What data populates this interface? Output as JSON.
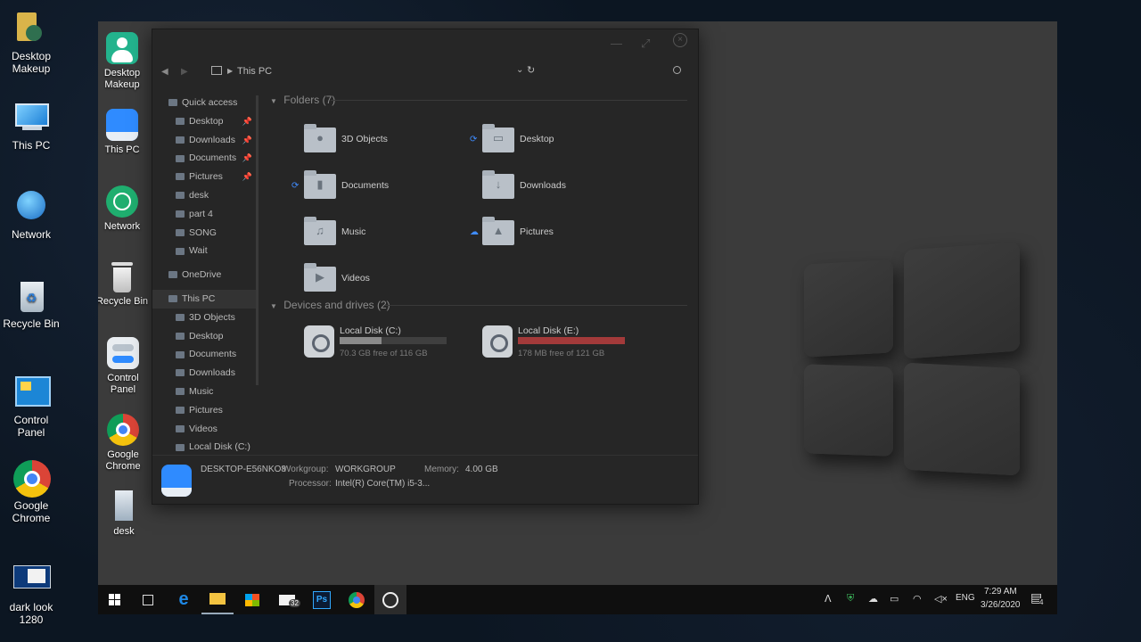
{
  "outer_desktop": [
    {
      "label": "Desktop Makeup",
      "icon": "folder-user-icon"
    },
    {
      "label": "This PC",
      "icon": "computer-icon"
    },
    {
      "label": "Network",
      "icon": "network-globe-icon"
    },
    {
      "label": "Recycle Bin",
      "icon": "recycle-bin-icon"
    },
    {
      "label": "Control Panel",
      "icon": "control-panel-icon"
    },
    {
      "label": "Google Chrome",
      "icon": "chrome-icon"
    },
    {
      "label": "dark look 1280",
      "icon": "shortcut-icon"
    }
  ],
  "inner_desktop": [
    {
      "label": "Desktop Makeup",
      "icon": "user-icon"
    },
    {
      "label": "This PC",
      "icon": "computer-icon"
    },
    {
      "label": "Network",
      "icon": "network-icon"
    },
    {
      "label": "Recycle Bin",
      "icon": "recycle-bin-icon"
    },
    {
      "label": "Control Panel",
      "icon": "toggle-icon"
    },
    {
      "label": "Google Chrome",
      "icon": "chrome-icon"
    },
    {
      "label": "desk",
      "icon": "document-icon"
    }
  ],
  "explorer": {
    "address": "This PC",
    "nav": {
      "quick_access": "Quick access",
      "quick_items": [
        {
          "label": "Desktop",
          "pinned": true
        },
        {
          "label": "Downloads",
          "pinned": true
        },
        {
          "label": "Documents",
          "pinned": true
        },
        {
          "label": "Pictures",
          "pinned": true
        },
        {
          "label": "desk",
          "pinned": false
        },
        {
          "label": "part 4",
          "pinned": false
        },
        {
          "label": "SONG",
          "pinned": false
        },
        {
          "label": "Wait",
          "pinned": false
        }
      ],
      "onedrive": "OneDrive",
      "this_pc": "This PC",
      "pc_items": [
        "3D Objects",
        "Desktop",
        "Documents",
        "Downloads",
        "Music",
        "Pictures",
        "Videos",
        "Local Disk (C:)"
      ]
    },
    "folders_header": "Folders (7)",
    "folders": [
      {
        "name": "3D Objects",
        "glyph": "●",
        "sync": ""
      },
      {
        "name": "Desktop",
        "glyph": "▭",
        "sync": "⟳"
      },
      {
        "name": "Documents",
        "glyph": "▮",
        "sync": "⟳"
      },
      {
        "name": "Downloads",
        "glyph": "↓",
        "sync": ""
      },
      {
        "name": "Music",
        "glyph": "♫",
        "sync": ""
      },
      {
        "name": "Pictures",
        "glyph": "▲",
        "sync": "☁"
      },
      {
        "name": "Videos",
        "glyph": "▶",
        "sync": ""
      }
    ],
    "drives_header": "Devices and drives (2)",
    "drives": [
      {
        "name": "Local Disk (C:)",
        "free": "70.3 GB free of 116 GB",
        "used_fraction": 0.39,
        "bar_color": "#8a8a8a"
      },
      {
        "name": "Local Disk (E:)",
        "free": "178 MB free of 121 GB",
        "used_fraction": 0.999,
        "bar_color": "#a33a3a"
      }
    ],
    "details": {
      "computer_name": "DESKTOP-E56NKO8",
      "workgroup_label": "Workgroup:",
      "workgroup": "WORKGROUP",
      "memory_label": "Memory:",
      "memory": "4.00 GB",
      "processor_label": "Processor:",
      "processor": "Intel(R) Core(TM) i5-3..."
    }
  },
  "taskbar": {
    "apps": [
      "windows-start-icon",
      "task-view-icon",
      "edge-icon",
      "file-explorer-icon",
      "store-icon",
      "mail-icon",
      "photoshop-icon",
      "chrome-icon",
      "app-icon"
    ],
    "mail_badge": "32",
    "ps_label": "Ps",
    "lang": "ENG",
    "time": "7:29 AM",
    "date": "3/26/2020",
    "notif_count": "4"
  }
}
